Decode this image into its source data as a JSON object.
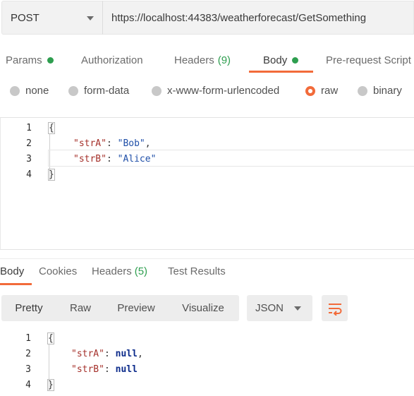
{
  "request": {
    "method": "POST",
    "url": "https://localhost:44383/weatherforecast/GetSomething"
  },
  "request_tabs": {
    "params": "Params",
    "authorization": "Authorization",
    "headers": "Headers",
    "headers_count": "(9)",
    "body": "Body",
    "prerequest": "Pre-request Script"
  },
  "body_types": {
    "none": "none",
    "form_data": "form-data",
    "urlencoded": "x-www-form-urlencoded",
    "raw": "raw",
    "binary": "binary",
    "selected": "raw"
  },
  "request_body": {
    "line_numbers": [
      "1",
      "2",
      "3",
      "4"
    ],
    "open_brace": "{",
    "key_a": "\"strA\"",
    "colon_a": ": ",
    "val_a": "\"Bob\"",
    "comma_a": ",",
    "key_b": "\"strB\"",
    "colon_b": ": ",
    "val_b": "\"Alice\"",
    "close_brace": "}"
  },
  "response_tabs": {
    "body": "Body",
    "cookies": "Cookies",
    "headers": "Headers",
    "headers_count": "(5)",
    "test_results": "Test Results"
  },
  "response_toolbar": {
    "pretty": "Pretty",
    "raw": "Raw",
    "preview": "Preview",
    "visualize": "Visualize",
    "language": "JSON",
    "wrap_icon": "wrap-lines-icon"
  },
  "response_body": {
    "line_numbers": [
      "1",
      "2",
      "3",
      "4"
    ],
    "open_brace": "{",
    "key_a": "\"strA\"",
    "colon_a": ": ",
    "val_a": "null",
    "comma_a": ",",
    "key_b": "\"strB\"",
    "colon_b": ": ",
    "val_b": "null",
    "close_brace": "}"
  },
  "colors": {
    "accent": "#f26b3a",
    "success": "#2e9e4f",
    "json_key": "#a5312b",
    "json_string": "#1f4fa8"
  }
}
